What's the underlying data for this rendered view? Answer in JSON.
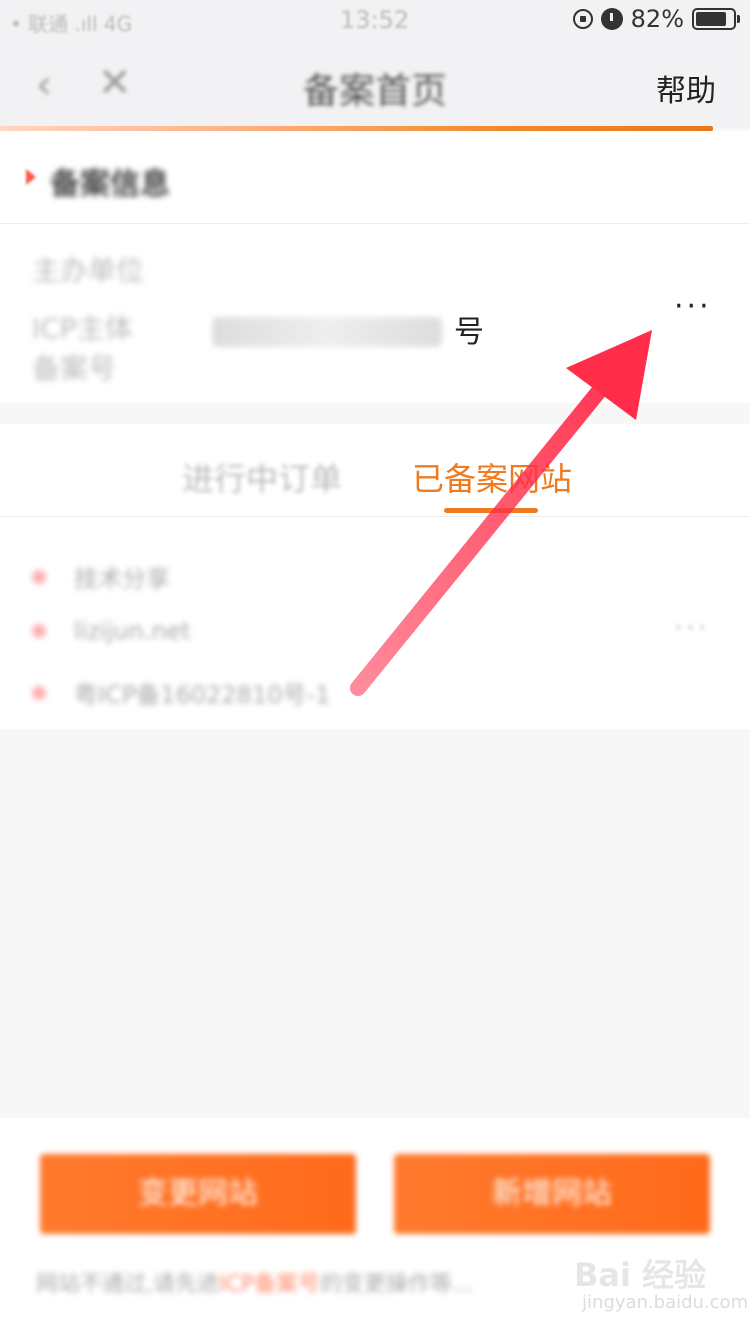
{
  "status_bar": {
    "carrier": "• 联通 .ıll 4G",
    "time": "13:52",
    "battery_percent": "82%"
  },
  "nav": {
    "back_icon": "chevron-left-icon",
    "close_icon": "close-icon",
    "title": "备案首页",
    "help_label": "帮助",
    "progress": 0.95
  },
  "info_card": {
    "section_title": "备案信息",
    "unit_label": "主办单位",
    "icp_label": "ICP主体备案号",
    "icp_suffix": "号",
    "more_label": "···"
  },
  "tabs": {
    "in_progress": "进行中订单",
    "recorded": "已备案网站",
    "active": "recorded"
  },
  "site_list": {
    "items": [
      "技术分享",
      "lizijun.net",
      "粤ICP备16022810号-1"
    ],
    "more_label": "···"
  },
  "bottom": {
    "change_button": "变更网站",
    "add_button": "新增网站",
    "tip_prefix": "网站不通过,请先进",
    "tip_highlight": "ICP备案号",
    "tip_suffix": "的变更操作等..."
  },
  "watermark": {
    "main": "Bai 经验",
    "sub": "jingyan.baidu.com"
  },
  "colors": {
    "accent": "#f07a1e",
    "arrow": "#ff2d4a",
    "button": "#ff6a1a"
  }
}
